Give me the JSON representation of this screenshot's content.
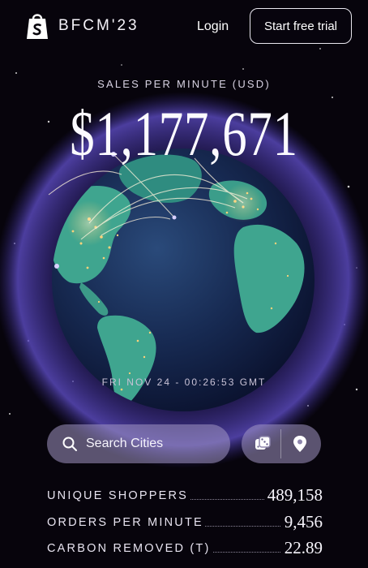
{
  "header": {
    "brand": "BFCM'23",
    "login_label": "Login",
    "trial_label": "Start free trial"
  },
  "hero": {
    "subtitle": "SALES PER MINUTE (USD)",
    "value": "$1,177,671",
    "timestamp": "FRI NOV 24 - 00:26:53 GMT"
  },
  "search": {
    "label": "Search Cities"
  },
  "controls": {
    "random_icon": "dice-icon",
    "locate_icon": "location-pin-icon"
  },
  "stats": [
    {
      "label": "UNIQUE SHOPPERS",
      "value": "489,158"
    },
    {
      "label": "ORDERS PER MINUTE",
      "value": "9,456"
    },
    {
      "label": "CARBON REMOVED (T)",
      "value": "22.89"
    }
  ],
  "colors": {
    "background": "#07040c",
    "halo": "#4a3aa8",
    "ocean": "#17305a",
    "land": "#3fa090",
    "city_lights": "#ffd27a"
  }
}
